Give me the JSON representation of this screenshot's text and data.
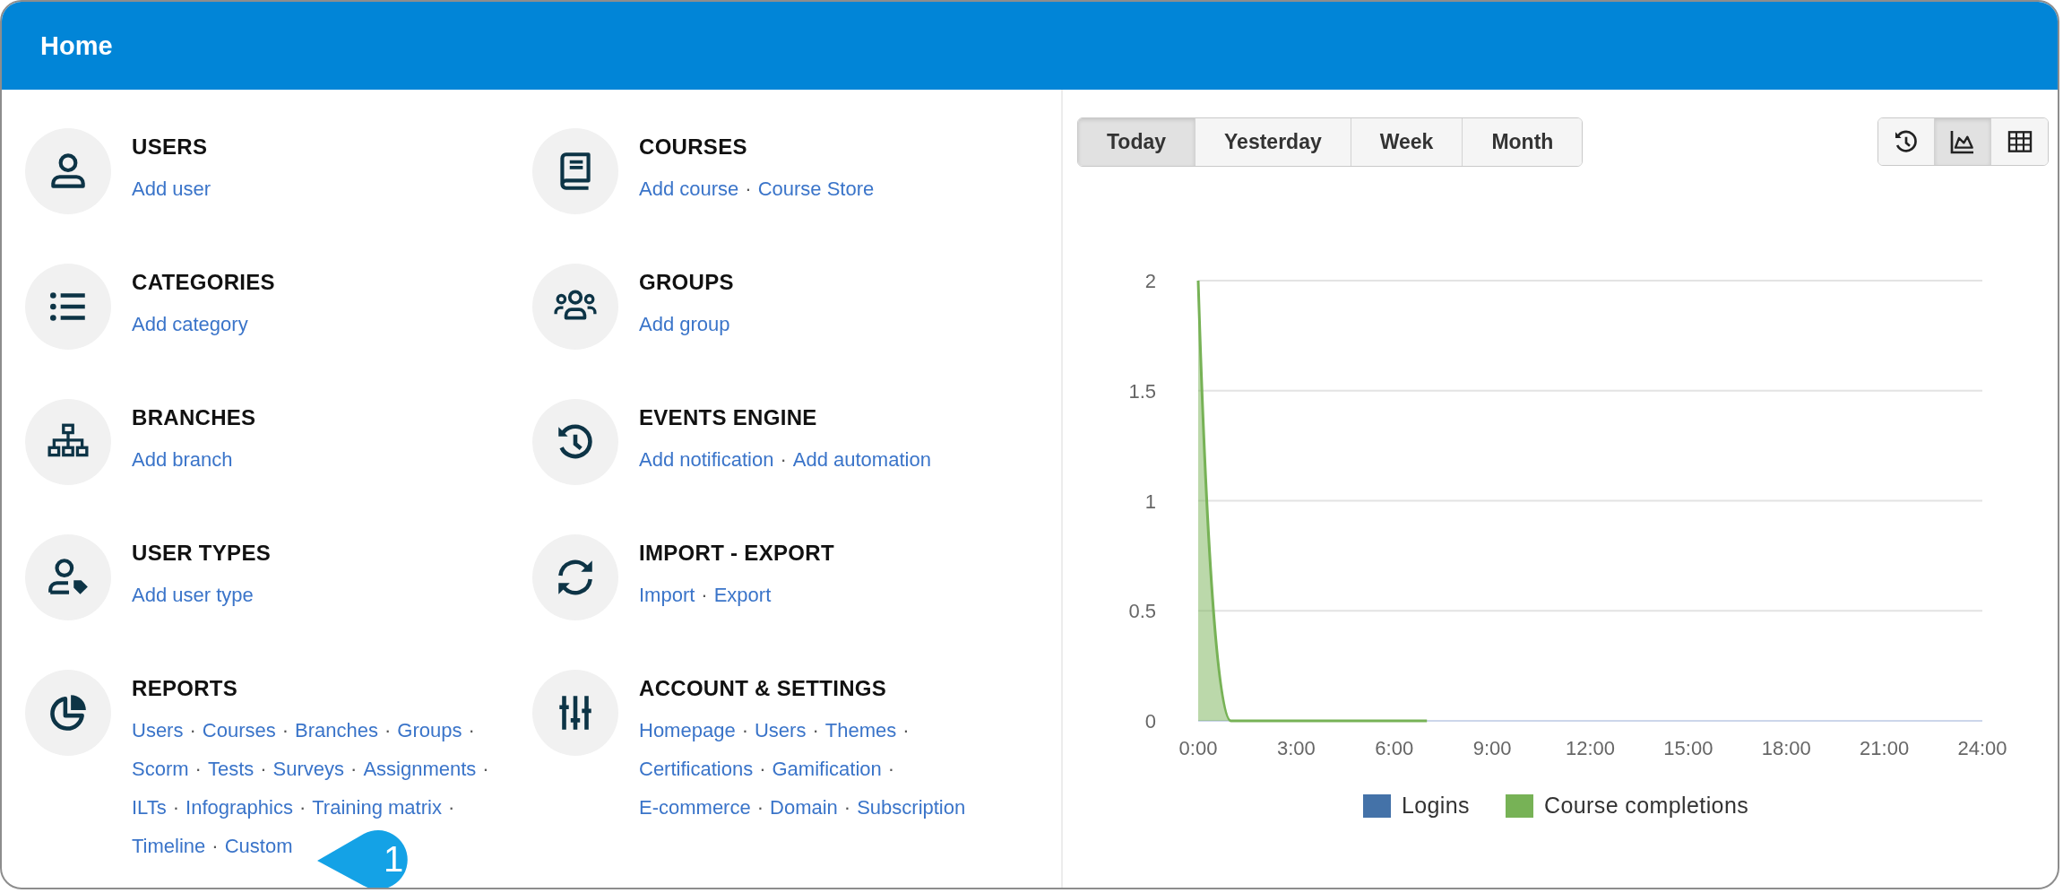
{
  "window": {
    "title": "Home"
  },
  "columns": [
    {
      "sections": [
        {
          "kind": "user",
          "title": "USERS",
          "links": [
            {
              "label": "Add user"
            }
          ]
        },
        {
          "kind": "list",
          "title": "CATEGORIES",
          "links": [
            {
              "label": "Add category"
            }
          ]
        },
        {
          "kind": "sitemap",
          "title": "BRANCHES",
          "links": [
            {
              "label": "Add branch"
            }
          ]
        },
        {
          "kind": "user-tag",
          "title": "USER TYPES",
          "links": [
            {
              "label": "Add user type"
            }
          ]
        },
        {
          "kind": "pie",
          "title": "REPORTS",
          "links": [
            {
              "label": "Users",
              "sep": "·"
            },
            {
              "label": "Courses",
              "sep": "·"
            },
            {
              "label": "Branches",
              "sep": "·"
            },
            {
              "label": "Groups",
              "sep": "·"
            },
            {
              "label": "Scorm",
              "sep": "·"
            },
            {
              "label": "Tests",
              "sep": "·"
            },
            {
              "label": "Surveys",
              "sep": "·"
            },
            {
              "label": "Assignments",
              "sep": "·"
            },
            {
              "label": "ILTs",
              "sep": "·"
            },
            {
              "label": "Infographics",
              "sep": "·"
            },
            {
              "label": "Training matrix",
              "sep": "·"
            },
            {
              "label": "Timeline",
              "sep": "·"
            },
            {
              "label": "Custom"
            }
          ]
        }
      ]
    },
    {
      "sections": [
        {
          "kind": "book",
          "title": "COURSES",
          "links": [
            {
              "label": "Add course",
              "sep": "·"
            },
            {
              "label": "Course Store"
            }
          ]
        },
        {
          "kind": "users",
          "title": "GROUPS",
          "links": [
            {
              "label": "Add group"
            }
          ]
        },
        {
          "kind": "history",
          "title": "EVENTS ENGINE",
          "links": [
            {
              "label": "Add notification",
              "sep": "·"
            },
            {
              "label": "Add automation"
            }
          ]
        },
        {
          "kind": "sync",
          "title": "IMPORT - EXPORT",
          "links": [
            {
              "label": "Import",
              "sep": "·"
            },
            {
              "label": "Export"
            }
          ]
        },
        {
          "kind": "sliders",
          "title": "ACCOUNT & SETTINGS",
          "links": [
            {
              "label": "Homepage",
              "sep": "·"
            },
            {
              "label": "Users",
              "sep": "·"
            },
            {
              "label": "Themes",
              "sep": "·"
            },
            {
              "label": "Certifications",
              "sep": "·"
            },
            {
              "label": "Gamification",
              "sep": "·"
            },
            {
              "label": "E-commerce",
              "sep": "·"
            },
            {
              "label": "Domain",
              "sep": "·"
            },
            {
              "label": "Subscription"
            }
          ]
        }
      ]
    }
  ],
  "callout": {
    "text": "1"
  },
  "chart_panel": {
    "tabs": [
      {
        "label": "Today",
        "selected": true
      },
      {
        "label": "Yesterday",
        "selected": false
      },
      {
        "label": "Week",
        "selected": false
      },
      {
        "label": "Month",
        "selected": false
      }
    ],
    "view_buttons": [
      {
        "kind": "history",
        "selected": false
      },
      {
        "kind": "area-chart",
        "selected": true
      },
      {
        "kind": "table",
        "selected": false
      }
    ],
    "chart_data": {
      "type": "area",
      "x": [
        0,
        1,
        2,
        3,
        4,
        5,
        6,
        7
      ],
      "xlim": [
        0,
        24
      ],
      "ylim": [
        0,
        2
      ],
      "xticks": [
        {
          "value": 0,
          "label": "0:00"
        },
        {
          "value": 3,
          "label": "3:00"
        },
        {
          "value": 6,
          "label": "6:00"
        },
        {
          "value": 9,
          "label": "9:00"
        },
        {
          "value": 12,
          "label": "12:00"
        },
        {
          "value": 15,
          "label": "15:00"
        },
        {
          "value": 18,
          "label": "18:00"
        },
        {
          "value": 21,
          "label": "21:00"
        },
        {
          "value": 24,
          "label": "24:00"
        }
      ],
      "yticks": [
        0,
        0.5,
        1,
        1.5,
        2
      ],
      "grid": true,
      "series": [
        {
          "name": "Logins",
          "color": "#4472a8",
          "values": [
            null,
            null,
            null,
            null,
            null,
            null,
            null,
            null
          ]
        },
        {
          "name": "Course completions",
          "color": "#77b256",
          "values": [
            2,
            0,
            0,
            0,
            0,
            0,
            0,
            0
          ]
        }
      ]
    }
  }
}
